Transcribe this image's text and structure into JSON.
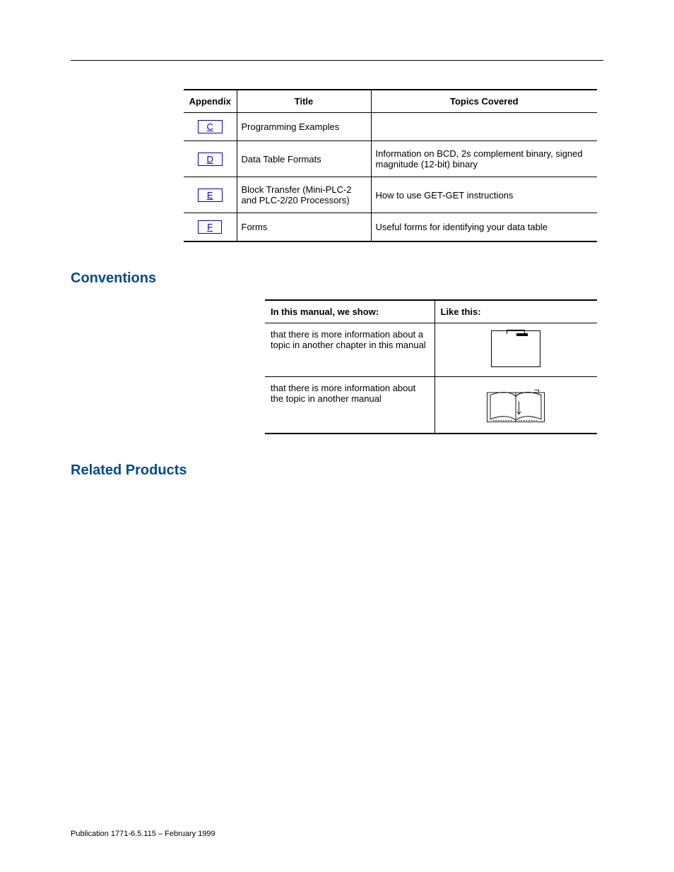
{
  "appendix_table": {
    "headers": {
      "appendix": "Appendix",
      "title": "Title",
      "topics": "Topics Covered"
    },
    "rows": [
      {
        "letter": "C",
        "title": "Programming Examples",
        "topics": ""
      },
      {
        "letter": "D",
        "title": "Data Table Formats",
        "topics": "Information on BCD, 2s complement binary, signed magnitude (12-bit) binary"
      },
      {
        "letter": "E",
        "title": "Block Transfer (Mini-PLC-2 and PLC-2/20 Processors)",
        "topics": "How to use GET-GET instructions"
      },
      {
        "letter": "F",
        "title": "Forms",
        "topics": "Useful forms for identifying your data table"
      }
    ]
  },
  "headings": {
    "conventions": "Conventions",
    "related_products": "Related Products"
  },
  "conventions_table": {
    "headers": {
      "show": "In this manual, we show:",
      "like": "Like this:"
    },
    "rows": [
      {
        "text": "that there is more information about a topic in another chapter in this manual",
        "icon": "page-icon"
      },
      {
        "text": "that there is more information about the topic in another manual",
        "icon": "book-icon"
      }
    ]
  },
  "footer": "Publication 1771-6.5.115 – February 1999"
}
